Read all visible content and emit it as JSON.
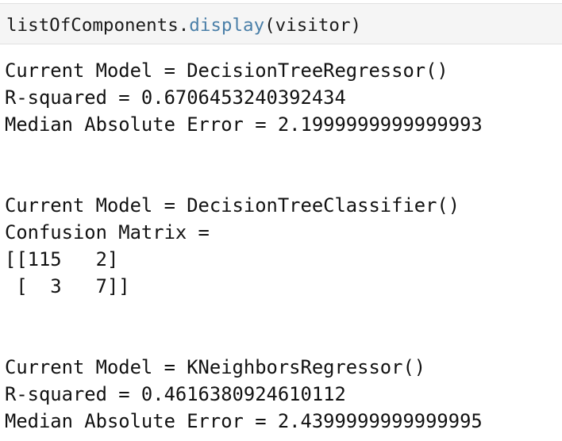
{
  "input_cell": {
    "object": "listOfComponents",
    "dot": ".",
    "method": "display",
    "args": "(visitor)"
  },
  "output_lines": [
    "Current Model = DecisionTreeRegressor()",
    "R-squared = 0.6706453240392434",
    "Median Absolute Error = 2.1999999999999993",
    "",
    "",
    "Current Model = DecisionTreeClassifier()",
    "Confusion Matrix =",
    "[[115   2]",
    " [  3   7]]",
    "",
    "",
    "Current Model = KNeighborsRegressor()",
    "R-squared = 0.4616380924610112",
    "Median Absolute Error = 2.4399999999999995"
  ],
  "colors": {
    "method_token": "#4a7fa8",
    "cell_background": "#f5f5f5"
  }
}
